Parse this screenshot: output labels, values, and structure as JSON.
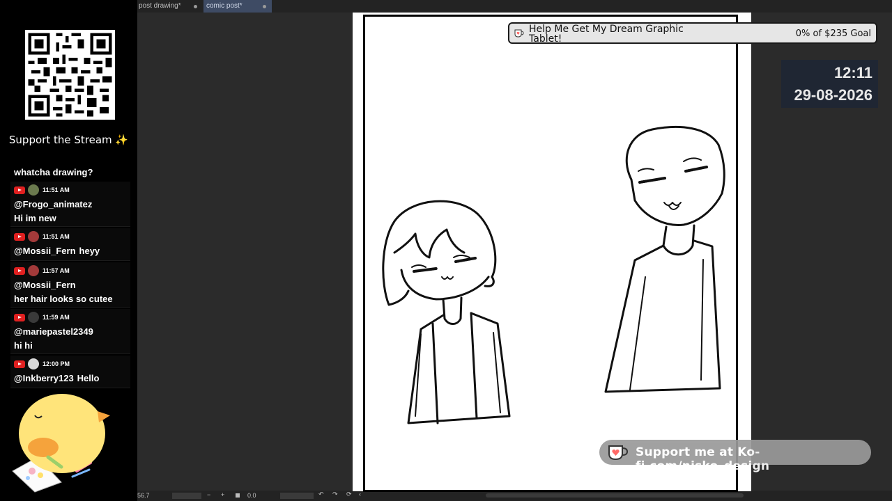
{
  "support_title": "Support the Stream ✨",
  "chat": {
    "first_line": "whatcha drawing?",
    "messages": [
      {
        "time": "11:51 AM",
        "user": "@Frogo_animatez",
        "text": "Hi im new",
        "inline": false
      },
      {
        "time": "11:51 AM",
        "user": "@Mossii_Fern",
        "text": "heyy",
        "inline": true
      },
      {
        "time": "11:57 AM",
        "user": "@Mossii_Fern",
        "text": "her hair looks so cutee",
        "inline": false
      },
      {
        "time": "11:59 AM",
        "user": "@mariepastel2349",
        "text": "hi hi",
        "inline": false
      },
      {
        "time": "12:00 PM",
        "user": "@Inkberry123",
        "text": "Hello",
        "inline": true
      }
    ]
  },
  "tabs": [
    {
      "label": "post drawing*"
    },
    {
      "label": "comic post*"
    }
  ],
  "statusbar": {
    "zoom": "56.7",
    "rotation": "0.0"
  },
  "goal_widget": {
    "title": "Help Me Get My Dream Graphic Tablet!",
    "progress_label": "0% of $235 Goal",
    "progress": 0
  },
  "clock": {
    "time": "12:11",
    "date": "29-08-2026"
  },
  "kofi_banner": {
    "text": "Support me at Ko-fi.com/nisko_design"
  },
  "colors": {
    "youtube_red": "#e02020",
    "kofi_red": "#ff5e5b",
    "active_tab": "#3e4b64",
    "clock_bg": "#1f2633"
  },
  "icons": [
    "qr-code-icon",
    "youtube-icon",
    "kofi-cup-icon",
    "minus-icon",
    "plus-icon",
    "stop-icon",
    "undo-icon",
    "redo-icon",
    "rotate-icon"
  ]
}
